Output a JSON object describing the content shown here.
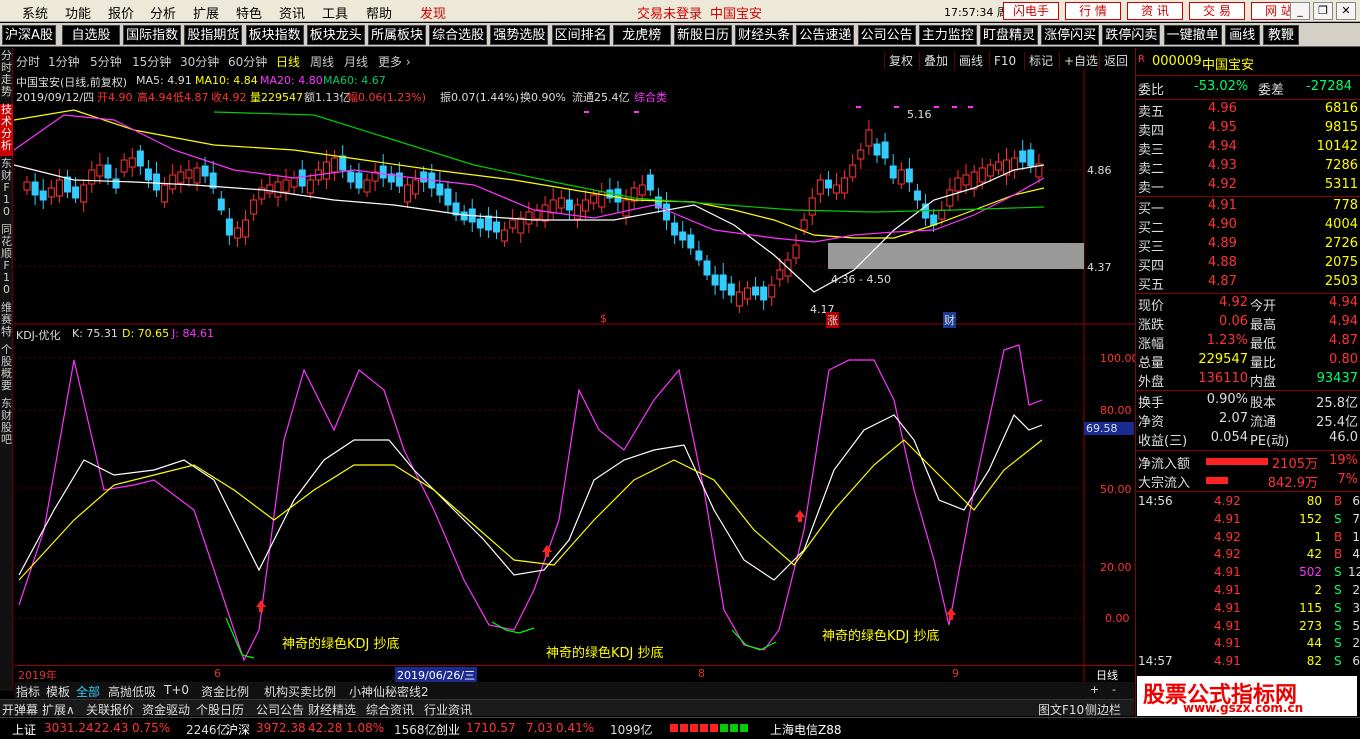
{
  "menubar": {
    "items": [
      "系统",
      "功能",
      "报价",
      "分析",
      "扩展",
      "特色",
      "资讯",
      "工具",
      "帮助"
    ],
    "highlight": "发现",
    "login_status": "交易未登录",
    "stock_name": "中国宝安",
    "clock": "17:57:34 周六",
    "buttons": [
      "闪电手",
      "行 情",
      "资 讯",
      "交 易",
      "网 站"
    ],
    "win_buttons": [
      "_",
      "❐",
      "✕"
    ]
  },
  "toolbar": {
    "buttons": [
      "沪深A股",
      "自选股",
      "国际指数",
      "股指期货",
      "板块指数",
      "板块龙头",
      "所属板块",
      "综合选股",
      "强势选股",
      "区间排名",
      "龙虎榜",
      "新股日历",
      "财经头条",
      "公告速递",
      "公司公告",
      "主力监控",
      "盯盘精灵",
      "涨停闪买",
      "跌停闪卖",
      "一键撤单",
      "画线",
      "教鞭"
    ]
  },
  "left_tabs": [
    {
      "label": "分时走势",
      "active": false
    },
    {
      "label": "技术分析",
      "active": true
    },
    {
      "label": "东财F10",
      "active": false
    },
    {
      "label": "同花顺F10",
      "active": false
    },
    {
      "label": "维赛特",
      "active": false
    },
    {
      "label": "个股概要",
      "active": false
    },
    {
      "label": "东财股吧",
      "active": false
    }
  ],
  "period_bar": {
    "items": [
      "分时",
      "1分钟",
      "5分钟",
      "15分钟",
      "30分钟",
      "60分钟",
      "日线",
      "周线",
      "月线",
      "更多 ›"
    ],
    "active": "日线",
    "right_buttons": [
      "复权",
      "叠加",
      "画线",
      "F10",
      "标记",
      "+自选",
      "返回"
    ]
  },
  "main_info": {
    "name": "中国宝安(日线,前复权)",
    "ma5": "MA5: 4.91",
    "ma10": "MA10: 4.84",
    "ma20": "MA20: 4.80",
    "ma60": "MA60: 4.67",
    "date": "2019/09/12/四",
    "open": "开4.90",
    "high": "高4.94",
    "low": "低4.87",
    "close": "收4.92",
    "vol": "量229547",
    "amount": "额1.13亿",
    "change": "幅0.06(1.23%)",
    "amp": "振0.07(1.44%)",
    "turnover": "换0.90%",
    "float": "流通25.4亿",
    "sector": "综合类"
  },
  "annotations": {
    "high": "5.16",
    "low": "4.17",
    "range": "4.36 - 4.50",
    "marker_s": "$",
    "marker_zhang": "涨",
    "marker_cai": "财"
  },
  "price_axis": [
    "4.86",
    "4.37"
  ],
  "kdj": {
    "title": "KDJ-优化",
    "k": "K: 75.31",
    "d": "D: 70.65",
    "j": "J: 84.61",
    "current": "69.58",
    "axis": [
      "100.00",
      "80.00",
      "50.00",
      "20.00",
      "0.00"
    ],
    "caption": "神奇的绿色KDJ 抄底"
  },
  "dates": {
    "year": "2019年",
    "m6": "6",
    "cursor": "2019/06/26/三",
    "m8": "8",
    "m9": "9",
    "period": "日线"
  },
  "indicator_tabs": [
    "指标",
    "模板",
    "全部",
    "高抛低吸",
    "T+0",
    "资金比例",
    "机构买卖比例",
    "小神仙秘密线2"
  ],
  "bottom_tabs": [
    "开弹幕",
    "扩展∧",
    "关联报价",
    "资金驱动",
    "个股日历",
    "公司公告",
    "财经精选",
    "综合资讯",
    "行业资讯"
  ],
  "bottom_right": [
    "图文F10",
    "侧边栏 <"
  ],
  "statusbar": {
    "sh_label": "上证",
    "sh_val": "3031.24",
    "sh_chg": "22.43",
    "sh_pct": "0.75%",
    "sh_amt": "2246亿",
    "hs_label": "沪深",
    "hs_val": "3972.38",
    "hs_chg": "42.28",
    "hs_pct": "1.08%",
    "hs_amt": "1568亿",
    "cy_label": "创业",
    "cy_val": "1710.57",
    "cy_chg": "7.03",
    "cy_pct": "0.41%",
    "cy_amt": "1099亿",
    "isp": "上海电信Z88"
  },
  "quote": {
    "code": "000009",
    "name": "中国宝安",
    "weibi_label": "委比",
    "weibi": "-53.02%",
    "weicha_label": "委差",
    "weicha": "-27284",
    "sells": [
      {
        "label": "卖五",
        "price": "4.96",
        "vol": "6816"
      },
      {
        "label": "卖四",
        "price": "4.95",
        "vol": "9815"
      },
      {
        "label": "卖三",
        "price": "4.94",
        "vol": "10142"
      },
      {
        "label": "卖二",
        "price": "4.93",
        "vol": "7286"
      },
      {
        "label": "卖一",
        "price": "4.92",
        "vol": "5311"
      }
    ],
    "buys": [
      {
        "label": "买一",
        "price": "4.91",
        "vol": "778"
      },
      {
        "label": "买二",
        "price": "4.90",
        "vol": "4004"
      },
      {
        "label": "买三",
        "price": "4.89",
        "vol": "2726"
      },
      {
        "label": "买四",
        "price": "4.88",
        "vol": "2075"
      },
      {
        "label": "买五",
        "price": "4.87",
        "vol": "2503"
      }
    ],
    "stats": [
      [
        "现价",
        "4.92",
        "今开",
        "4.94"
      ],
      [
        "涨跌",
        "0.06",
        "最高",
        "4.94"
      ],
      [
        "涨幅",
        "1.23%",
        "最低",
        "4.87"
      ],
      [
        "总量",
        "229547",
        "量比",
        "0.80"
      ],
      [
        "外盘",
        "136110",
        "内盘",
        "93437"
      ]
    ],
    "stats2": [
      [
        "换手",
        "0.90%",
        "股本",
        "25.8亿"
      ],
      [
        "净资",
        "2.07",
        "流通",
        "25.4亿"
      ],
      [
        "收益(三)",
        "0.054",
        "PE(动)",
        "46.0"
      ]
    ],
    "flow": [
      {
        "label": "净流入额",
        "val": "2105万",
        "pct": "19%"
      },
      {
        "label": "大宗流入",
        "val": "842.9万",
        "pct": "7%"
      }
    ],
    "ticks": [
      {
        "time": "14:56",
        "price": "4.92",
        "vol": "80",
        "bs": "B",
        "n": "6"
      },
      {
        "time": "",
        "price": "4.91",
        "vol": "152",
        "bs": "S",
        "n": "7"
      },
      {
        "time": "",
        "price": "4.92",
        "vol": "1",
        "bs": "B",
        "n": "1"
      },
      {
        "time": "",
        "price": "4.92",
        "vol": "42",
        "bs": "B",
        "n": "4"
      },
      {
        "time": "",
        "price": "4.91",
        "vol": "502",
        "bs": "S",
        "n": "12"
      },
      {
        "time": "",
        "price": "4.91",
        "vol": "2",
        "bs": "S",
        "n": "2"
      },
      {
        "time": "",
        "price": "4.91",
        "vol": "115",
        "bs": "S",
        "n": "3"
      },
      {
        "time": "",
        "price": "4.91",
        "vol": "273",
        "bs": "S",
        "n": "5"
      },
      {
        "time": "",
        "price": "4.91",
        "vol": "44",
        "bs": "S",
        "n": "2"
      },
      {
        "time": "14:57",
        "price": "4.91",
        "vol": "82",
        "bs": "S",
        "n": "6"
      }
    ]
  },
  "watermark": {
    "title": "股票公式指标网",
    "url": "www.gszx.com.cn"
  },
  "colors": {
    "up": "#ff3333",
    "down": "#33ccff",
    "ma5": "#ffffff",
    "ma10": "#ffff00",
    "ma20": "#ff33ff",
    "ma60": "#00cc00"
  }
}
